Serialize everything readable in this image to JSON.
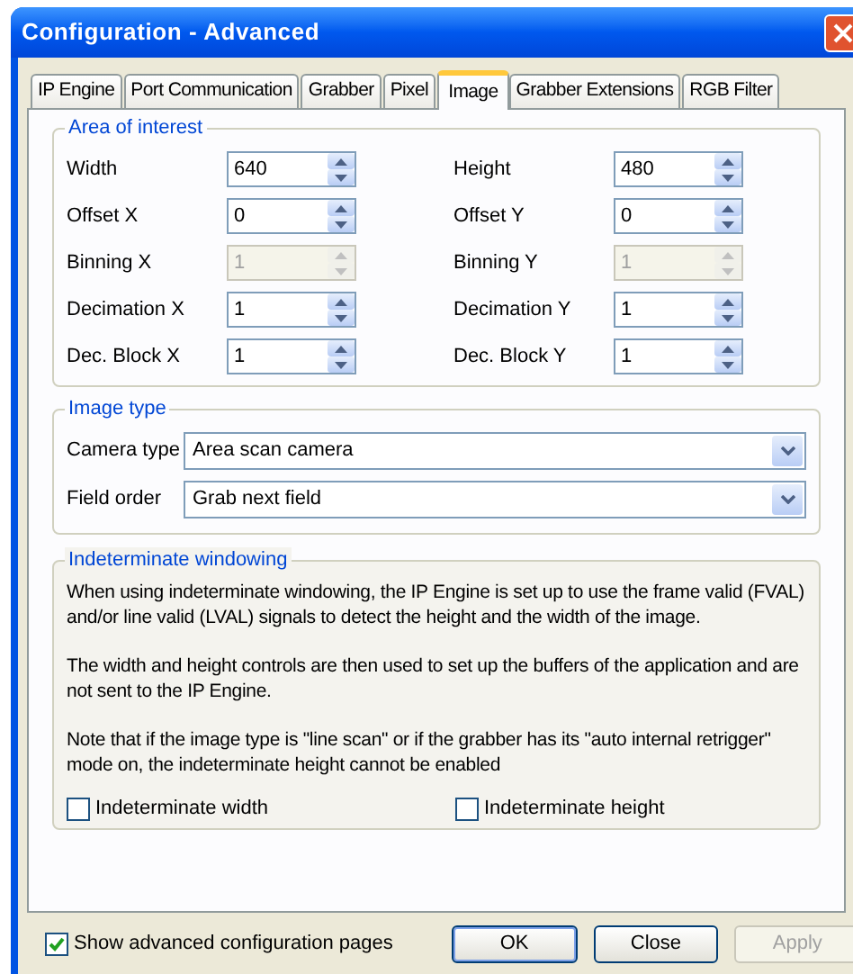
{
  "window": {
    "title": "Configuration - Advanced"
  },
  "tabs": [
    {
      "label": "IP Engine",
      "selected": false
    },
    {
      "label": "Port Communication",
      "selected": false
    },
    {
      "label": "Grabber",
      "selected": false
    },
    {
      "label": "Pixel",
      "selected": false
    },
    {
      "label": "Image",
      "selected": true
    },
    {
      "label": "Grabber Extensions",
      "selected": false
    },
    {
      "label": "RGB Filter",
      "selected": false
    }
  ],
  "area_of_interest": {
    "title": "Area of interest",
    "rows": [
      [
        {
          "label": "Width",
          "value": "640",
          "disabled": false
        },
        {
          "label": "Height",
          "value": "480",
          "disabled": false
        }
      ],
      [
        {
          "label": "Offset X",
          "value": "0",
          "disabled": false
        },
        {
          "label": "Offset Y",
          "value": "0",
          "disabled": false
        }
      ],
      [
        {
          "label": "Binning X",
          "value": "1",
          "disabled": true
        },
        {
          "label": "Binning Y",
          "value": "1",
          "disabled": true
        }
      ],
      [
        {
          "label": "Decimation X",
          "value": "1",
          "disabled": false
        },
        {
          "label": "Decimation Y",
          "value": "1",
          "disabled": false
        }
      ],
      [
        {
          "label": "Dec. Block X",
          "value": "1",
          "disabled": false
        },
        {
          "label": "Dec. Block Y",
          "value": "1",
          "disabled": false
        }
      ]
    ]
  },
  "image_type": {
    "title": "Image type",
    "fields": [
      {
        "label": "Camera type",
        "value": "Area scan camera"
      },
      {
        "label": "Field order",
        "value": "Grab next field"
      }
    ]
  },
  "indeterminate_windowing": {
    "title": "Indeterminate windowing",
    "paragraphs": [
      "When using indeterminate windowing, the IP Engine is set up to use the frame valid (FVAL) and/or line valid (LVAL) signals to detect the height and the width of the image.",
      "The width and height controls are then used to set up the buffers of the application and are not sent to the IP Engine.",
      "Note that if the image type is \"line scan\" or if the grabber has its \"auto internal retrigger\" mode on, the indeterminate height cannot be enabled"
    ],
    "checkboxes": [
      {
        "label": "Indeterminate width",
        "checked": false
      },
      {
        "label": "Indeterminate height",
        "checked": false
      }
    ]
  },
  "footer": {
    "checkbox": {
      "label": "Show advanced configuration pages",
      "checked": true
    },
    "buttons": [
      {
        "label": "OK",
        "disabled": false,
        "default": true
      },
      {
        "label": "Close",
        "disabled": false,
        "default": false
      },
      {
        "label": "Apply",
        "disabled": true,
        "default": false
      }
    ]
  }
}
